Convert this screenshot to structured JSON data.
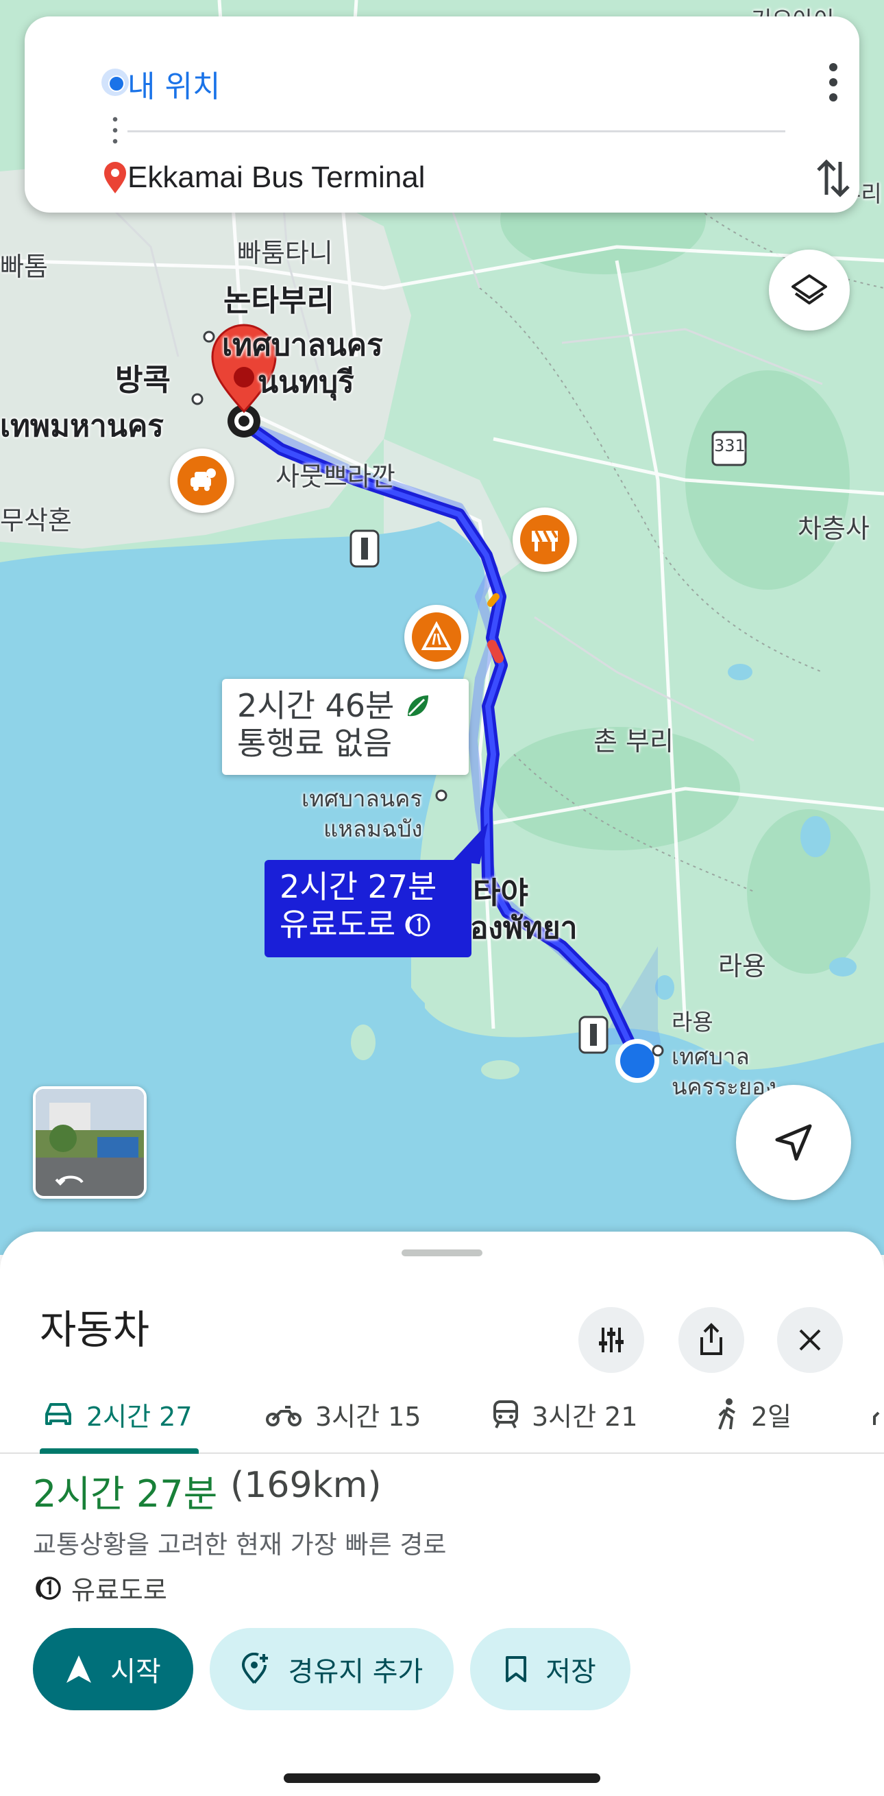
{
  "search": {
    "origin": "내 위치",
    "destination": "Ekkamai Bus Terminal"
  },
  "map": {
    "labels": {
      "top_right": "기오아이",
      "top_right_2": "부리",
      "left_top": "빠톰",
      "pathum_thani": "빠툼타니",
      "nonthaburi": "논타부리",
      "thesaban_nakhon": "เทศบาลนคร",
      "nonthaburi_th": "นนทบุรี",
      "bangkok": "방콕",
      "bangkok_th": "เทพมหานคร",
      "samut_prakan": "사뭇쁘라깐",
      "samut_sakhon": "무삭혼",
      "chachoengsao": "차층사",
      "chon_buri": "촌 부리",
      "laem_chabang_1": "เทศบาลนคร",
      "laem_chabang_2": "แหลมฉบัง",
      "pattaya": "타야",
      "pattaya_th": "องพัทยา",
      "rayong": "라용",
      "rayong_small": "라용",
      "rayong_th_1": "เทศบาล",
      "rayong_th_2": "นครระยอง",
      "route_331": "331"
    },
    "alt_route": {
      "time": "2시간 46분",
      "toll": "통행료 없음"
    },
    "main_route": {
      "time": "2시간 27분",
      "toll": "유료도로"
    }
  },
  "sheet": {
    "mode_title": "자동차",
    "tabs": [
      {
        "label": "2시간 27",
        "icon": "car-icon"
      },
      {
        "label": "3시간 15",
        "icon": "motorcycle-icon"
      },
      {
        "label": "3시간 21",
        "icon": "transit-icon"
      },
      {
        "label": "2일",
        "icon": "walk-icon"
      }
    ],
    "summary": {
      "time": "2시간 27분",
      "distance": "(169km)",
      "description": "교통상황을 고려한 현재 가장 빠른 경로",
      "toll": "유료도로"
    },
    "buttons": {
      "start": "시작",
      "add_stop": "경유지 추가",
      "save": "저장"
    }
  },
  "colors": {
    "route": "#1a1fd8",
    "water": "#8fd3e8",
    "land": "#b9e6cf",
    "accent": "#00707a",
    "incident": "#e8710a"
  }
}
